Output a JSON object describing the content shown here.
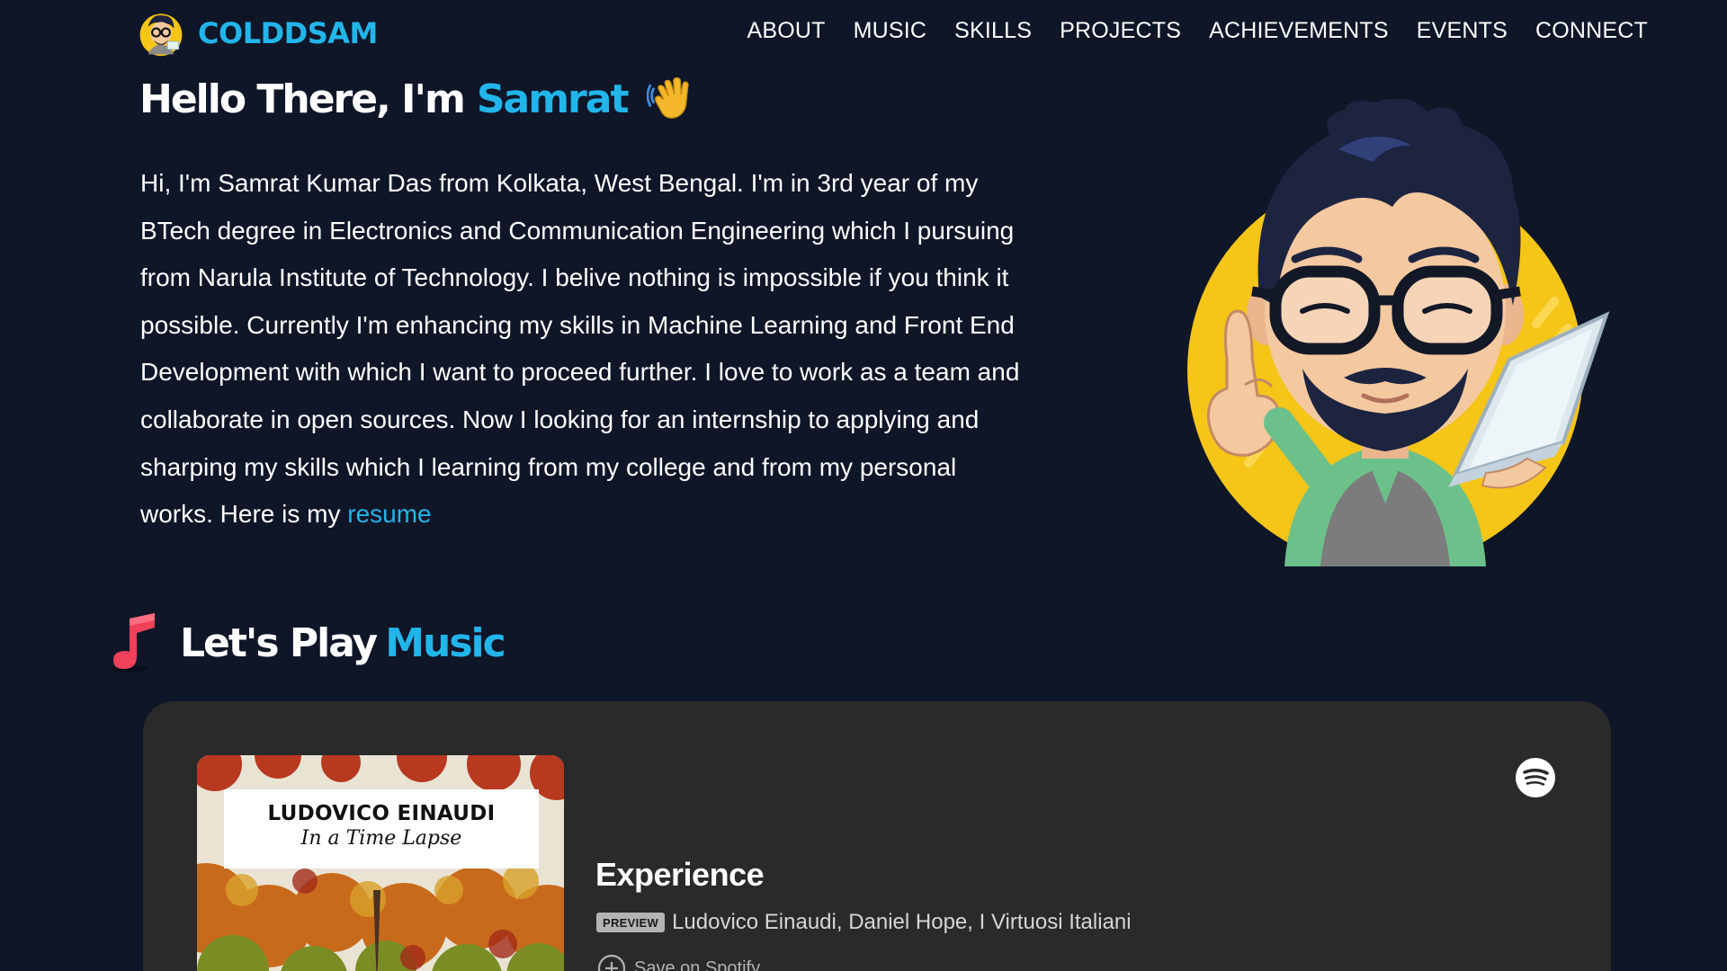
{
  "brand": {
    "name": "COLDDSAM"
  },
  "nav": {
    "items": [
      {
        "label": "ABOUT"
      },
      {
        "label": "MUSIC"
      },
      {
        "label": "SKILLS"
      },
      {
        "label": "PROJECTS"
      },
      {
        "label": "ACHIEVEMENTS"
      },
      {
        "label": "EVENTS"
      },
      {
        "label": "CONNECT"
      }
    ]
  },
  "hero": {
    "greeting": "Hello There, I'm",
    "name": "Samrat",
    "wave_icon": "waving-hand-icon",
    "bio": "Hi, I'm Samrat Kumar Das from Kolkata, West Bengal. I'm in 3rd year of my BTech degree in Electronics and Communication Engineering which I pursuing from Narula Institute of Technology. I belive nothing is impossible if you think it possible. Currently I'm enhancing my skills in Machine Learning and Front End Development with which I want to proceed further. I love to work as a team and collaborate in open sources. Now I looking for an internship to applying and sharping my skills which I learning from my college and from my personal works. Here is my",
    "resume_link": "resume"
  },
  "music": {
    "heading_prefix": "Let's Play",
    "heading_accent": "Music",
    "icon": "music-note-icon",
    "player": {
      "album_artist": "LUDOVICO EINAUDI",
      "album_title": "In a Time Lapse",
      "track_title": "Experience",
      "badge": "PREVIEW",
      "artists": "Ludovico Einaudi, Daniel Hope, I Virtuosi Italiani",
      "save_label": "Save on Spotify",
      "service_icon": "spotify-icon"
    }
  },
  "colors": {
    "background": "#0f1628",
    "accent": "#22b5ea",
    "player_bg": "#2a2a2a"
  }
}
